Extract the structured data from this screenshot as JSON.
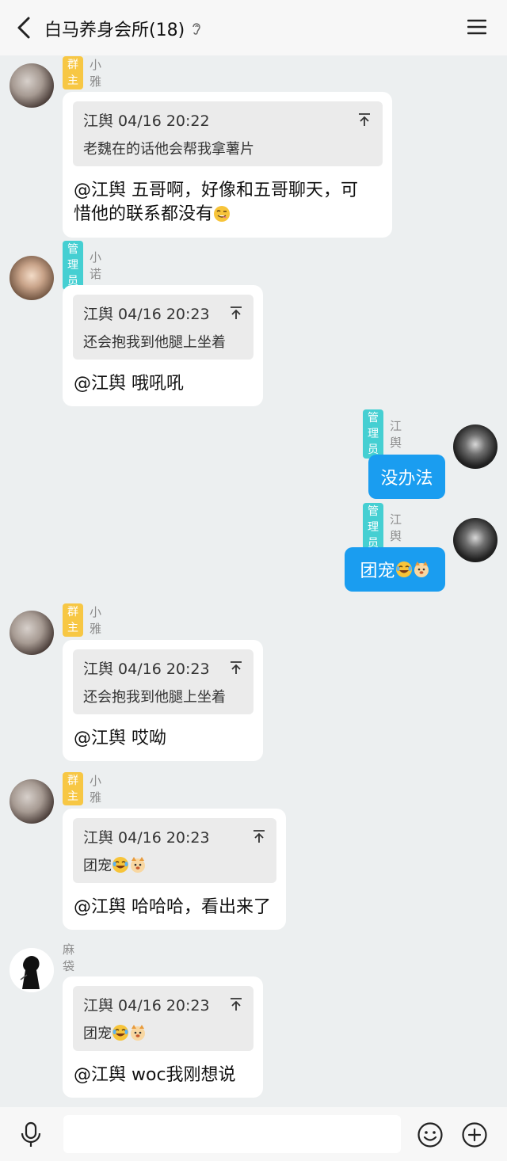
{
  "header": {
    "title": "白马养身会所(18)",
    "ear_icon": "ear-icon",
    "back_icon": "chevron-left-icon",
    "menu_icon": "hamburger-menu-icon"
  },
  "messages": [
    {
      "side": "left",
      "badge": "群主",
      "name": "小雅",
      "quote_header": "江舆 04/16 20:22",
      "quote_text": "老魏在的话他会帮我拿薯片",
      "text_line1": "@江舆 五哥啊，好像和五哥聊天，可",
      "text_line2": "惜他的联系都没有"
    },
    {
      "side": "left",
      "badge": "管理员",
      "name": "小诺",
      "quote_header": "江舆 04/16 20:23",
      "quote_text": "还会抱我到他腿上坐着",
      "text": "@江舆 哦吼吼"
    },
    {
      "side": "right",
      "badge": "管理员",
      "name": "江舆",
      "text": "没办法"
    },
    {
      "side": "right",
      "badge": "管理员",
      "name": "江舆",
      "text": "团宠"
    },
    {
      "side": "left",
      "badge": "群主",
      "name": "小雅",
      "quote_header": "江舆 04/16 20:23",
      "quote_text": "还会抱我到他腿上坐着",
      "text": "@江舆 哎呦"
    },
    {
      "side": "left",
      "badge": "群主",
      "name": "小雅",
      "quote_header": "江舆 04/16 20:23",
      "quote_text": "团宠",
      "text": "@江舆 哈哈哈，看出来了"
    },
    {
      "side": "left",
      "name": "麻袋",
      "quote_header": "江舆 04/16 20:23",
      "quote_text": "团宠",
      "text": "@江舆 woc我刚想说"
    }
  ],
  "bottom_bar": {
    "mic_icon": "microphone-icon",
    "input_value": "",
    "emoji_icon": "smiley-icon",
    "plus_icon": "plus-circle-icon"
  },
  "colors": {
    "background": "#eceff0",
    "owner_badge": "#f7c744",
    "admin_badge": "#45cfd2",
    "self_bubble": "#1a9df0"
  }
}
